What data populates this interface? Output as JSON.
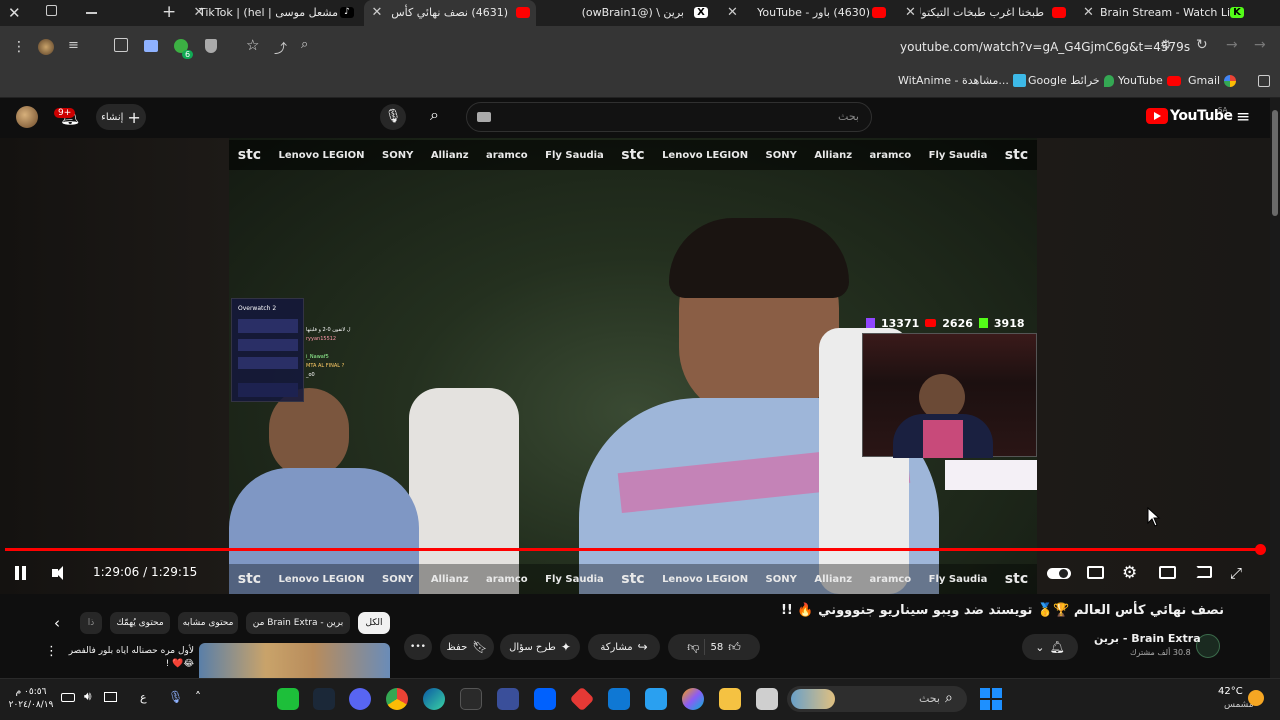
{
  "browser": {
    "tabs": [
      {
        "title": "مشعل موسى | TikTok | (hel",
        "favicon": "tiktok"
      },
      {
        "title": "(4631) نصف نهائي كأس",
        "favicon": "youtube",
        "active": true
      },
      {
        "title": "برين \\ (@owBrain1)",
        "favicon": "x"
      },
      {
        "title": "(4630) باور - YouTube",
        "favicon": "youtube"
      },
      {
        "title": "طبخنا اغرب طبخات التيكتوك",
        "favicon": "youtube"
      },
      {
        "title": "Brain Stream - Watch Live",
        "favicon": "kick"
      }
    ],
    "url": "youtube.com/watch?v=gA_G4GjmC6g&t=4579s",
    "extension_badge": "6",
    "bookmarks": [
      {
        "label": "Gmail",
        "icon": "google-icon"
      },
      {
        "label": "YouTube",
        "icon": "youtube-icon"
      },
      {
        "label": "خرائط Google",
        "icon": "maps-icon"
      },
      {
        "label": "WitAnime - مشاهدة...",
        "icon": "witanime-icon"
      }
    ]
  },
  "youtube": {
    "logo_text": "YouTube",
    "region": "SA",
    "search_placeholder": "بحث",
    "create_label": "إنشاء",
    "notifications_badge": "9+"
  },
  "video": {
    "time_current": "1:29:06",
    "time_separator": "/",
    "time_total": "1:29:15",
    "progress": 0.998,
    "sponsors": [
      "stc",
      "Lenovo LEGION",
      "SONY",
      "Allianz",
      "aramco",
      "Fly Saudia",
      "stc",
      "Lenovo LEGION",
      "SONY",
      "Allianz",
      "aramco",
      "Fly Saudia",
      "stc"
    ],
    "stats": {
      "twitch": "13371",
      "youtube": "2626",
      "kick": "3918"
    },
    "overlay_title": "Overwatch 2",
    "chat_lines": [
      "ل لاتفون 0-2 و قلبتها",
      "ryyan15512",
      "i_Nawaf5",
      "MTA AL FINAL ?",
      "_o0"
    ]
  },
  "watch": {
    "title": "نصف نهائي كأس العالم 🏆🥇 تويستد ضد ويبو سيناريو جنوووني 🔥 !!",
    "channel_name": "برين - Brain Extra",
    "subscribers": "30.8 ألف مشترك",
    "likes": "58",
    "share_label": "مشاركة",
    "ask_label": "طرح سؤال",
    "save_label": "حفظ",
    "more_label": "•••",
    "chips": [
      "الكل",
      "من Brain Extra - برين",
      "محتوى مشابه",
      "محتوى يُهمّك",
      "ذا"
    ],
    "rec_title": "لأول مره حصناله اياه بلور فالفصر 😂❤️ !"
  },
  "taskbar": {
    "search_placeholder": "بحث",
    "weather_temp": "42°C",
    "weather_desc": "مشمس",
    "clock_time": "٠٥:٥٦ م",
    "clock_date": "٢٠٢٤/٠٨/١٩",
    "lang": "ع"
  },
  "colors": {
    "youtube_red": "#ff0000",
    "chrome_tab": "#1f1f1f",
    "chrome_toolbar": "#353535",
    "yt_bg": "#0f0f0f",
    "pill_bg": "#272727"
  }
}
